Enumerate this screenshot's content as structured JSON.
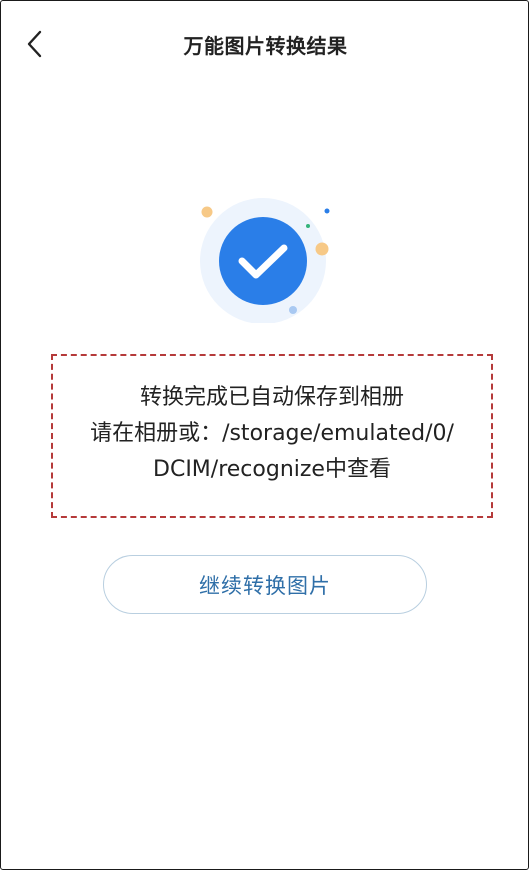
{
  "header": {
    "title": "万能图片转换结果",
    "back_icon": "chevron-left-icon"
  },
  "result": {
    "icon": "check-circle-icon",
    "accent_color": "#2a7ee8",
    "line1": "转换完成已自动保存到相册",
    "line2": "请在相册或：/storage/emulated/0/",
    "line3": "DCIM/recognize中查看"
  },
  "actions": {
    "continue_label": "继续转换图片"
  },
  "colors": {
    "dash_border": "#b53a3a",
    "button_text": "#2f6fa8",
    "button_border": "#b9cfe0"
  }
}
